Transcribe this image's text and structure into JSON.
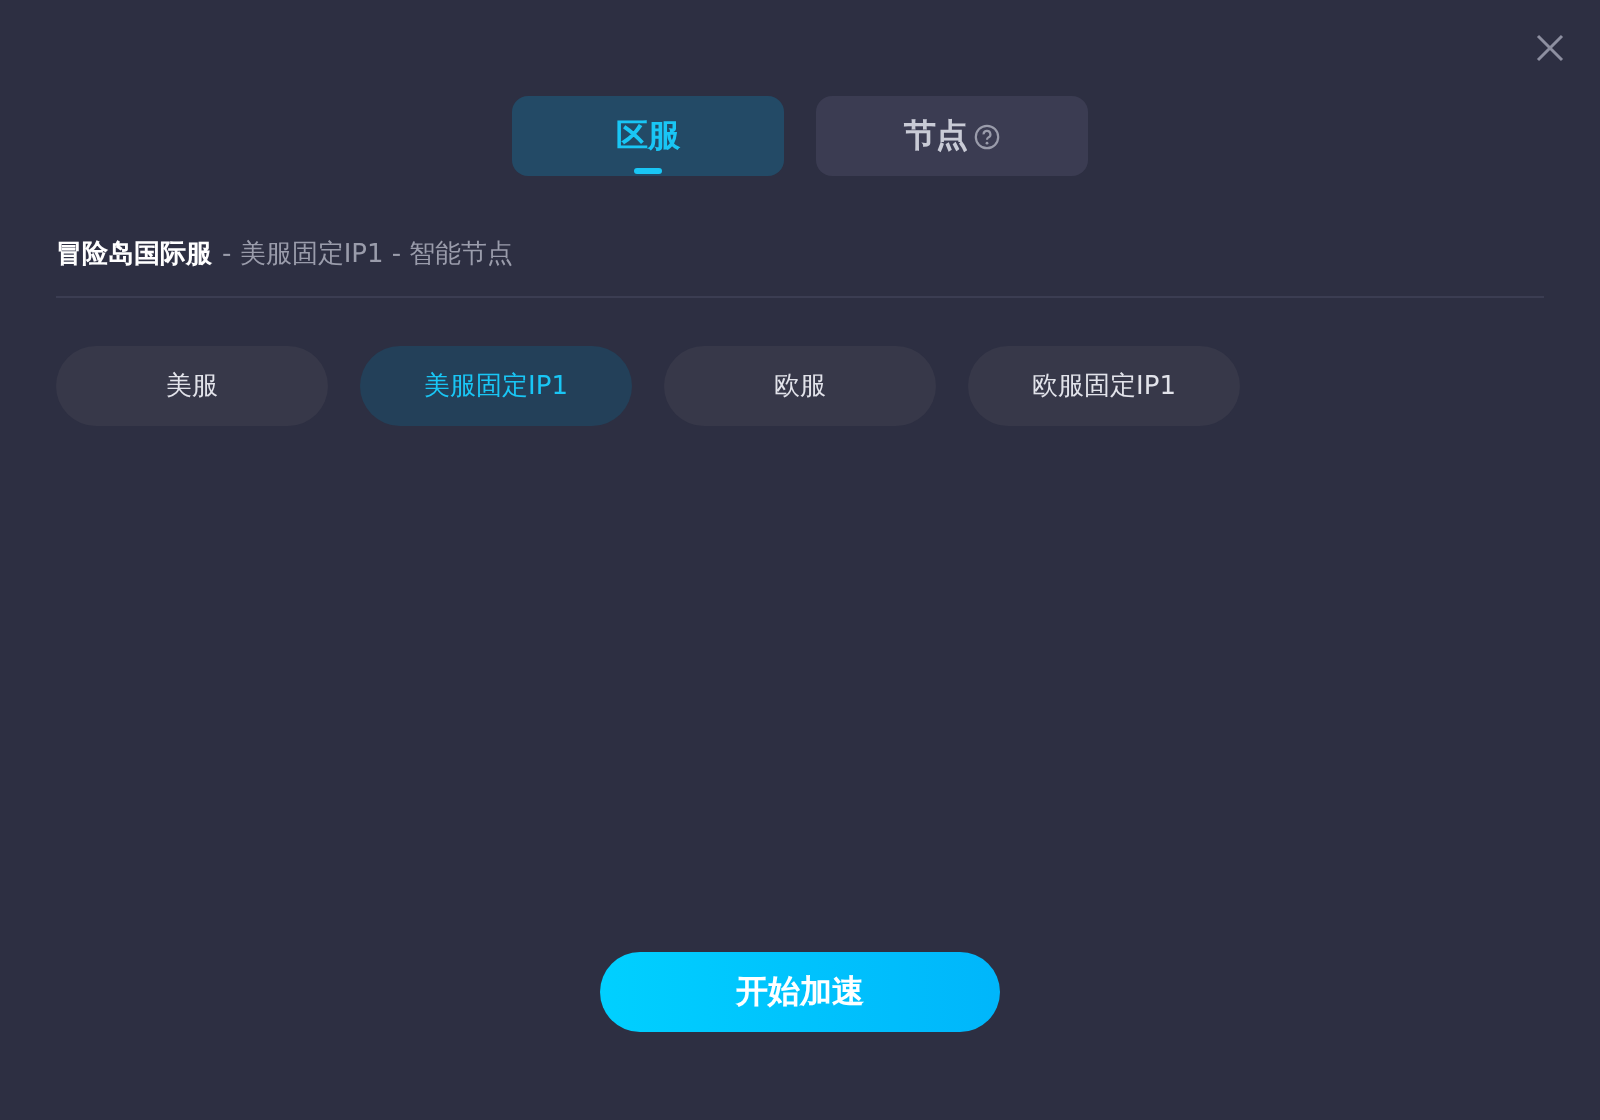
{
  "tabs": [
    {
      "label": "区服",
      "selected": true,
      "help_icon": false
    },
    {
      "label": "节点",
      "selected": false,
      "help_icon": true
    }
  ],
  "breadcrumb": {
    "game": "冒险岛国际服",
    "path": "- 美服固定IP1 - 智能节点"
  },
  "regions": [
    {
      "label": "美服",
      "selected": false
    },
    {
      "label": "美服固定IP1",
      "selected": true
    },
    {
      "label": "欧服",
      "selected": false
    },
    {
      "label": "欧服固定IP1",
      "selected": false
    }
  ],
  "start_button": "开始加速"
}
